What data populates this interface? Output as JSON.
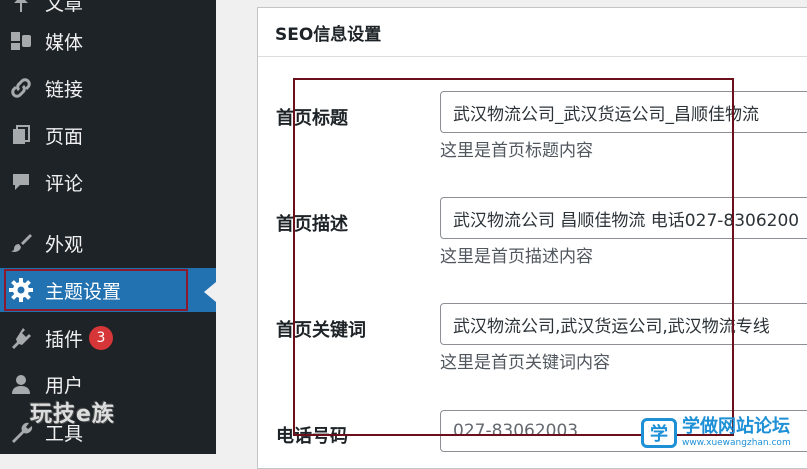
{
  "sidebar": {
    "items": [
      {
        "label": "文章",
        "icon": "pushpin-icon"
      },
      {
        "label": "媒体",
        "icon": "media-icon"
      },
      {
        "label": "链接",
        "icon": "link-icon"
      },
      {
        "label": "页面",
        "icon": "page-icon"
      },
      {
        "label": "评论",
        "icon": "comment-icon"
      },
      {
        "label": "外观",
        "icon": "brush-icon"
      },
      {
        "label": "主题设置",
        "icon": "gear-icon"
      },
      {
        "label": "插件",
        "icon": "plugin-icon",
        "badge": "3"
      },
      {
        "label": "用户",
        "icon": "user-icon"
      },
      {
        "label": "工具",
        "icon": "wrench-icon"
      }
    ],
    "active_index": 6,
    "accent_color": "#2271b1",
    "watermark": "玩技e族"
  },
  "panel": {
    "title": "SEO信息设置",
    "fields": [
      {
        "label": "首页标题",
        "value": "武汉物流公司_武汉货运公司_昌顺佳物流",
        "desc": "这里是首页标题内容"
      },
      {
        "label": "首页描述",
        "value": "武汉物流公司 昌顺佳物流 电话027-8306200",
        "desc": "这里是首页描述内容"
      },
      {
        "label": "首页关键词",
        "value": "武汉物流公司,武汉货运公司,武汉物流专线",
        "desc": "这里是首页关键词内容"
      },
      {
        "label": "电话号码",
        "placeholder": "027-83062003"
      }
    ]
  },
  "watermark_right": {
    "logo_char": "学",
    "name": "学做网站论坛",
    "url": "www.xuewangzhan.com"
  }
}
